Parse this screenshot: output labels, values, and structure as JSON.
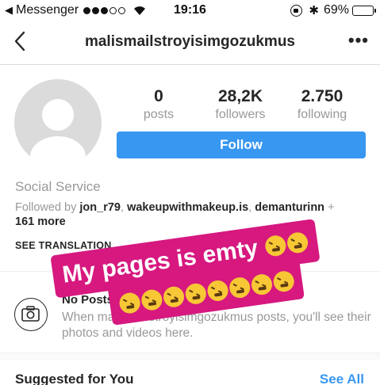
{
  "status_bar": {
    "back_app": "Messenger",
    "time": "19:16",
    "battery": "69%",
    "battery_level": 0.69
  },
  "nav": {
    "username": "malismailstroyisimgozukmus",
    "more": "•••"
  },
  "profile": {
    "stats": [
      {
        "value": "0",
        "label": "posts"
      },
      {
        "value": "28,2K",
        "label": "followers"
      },
      {
        "value": "2.750",
        "label": "following"
      }
    ],
    "follow_label": "Follow",
    "category": "Social Service",
    "followed_prefix": "Followed by ",
    "followed_users": [
      "jon_r79",
      "wakeupwithmakeup.is",
      "demanturinn"
    ],
    "followed_suffix": " +",
    "followed_more": "161 more",
    "see_translation": "SEE TRANSLATION"
  },
  "empty_state": {
    "title": "No Posts Yet",
    "description": "When malismailstroyisimgozukmus posts, you'll see their photos and videos here."
  },
  "suggested": {
    "title": "Suggested for You",
    "see_all": "See All"
  },
  "sticker": {
    "text": "My pages is emty",
    "emoji_count_line1": 2,
    "emoji_count_line2": 8,
    "color": "#d6187f"
  },
  "colors": {
    "accent": "#3897f0",
    "muted": "#999999"
  }
}
